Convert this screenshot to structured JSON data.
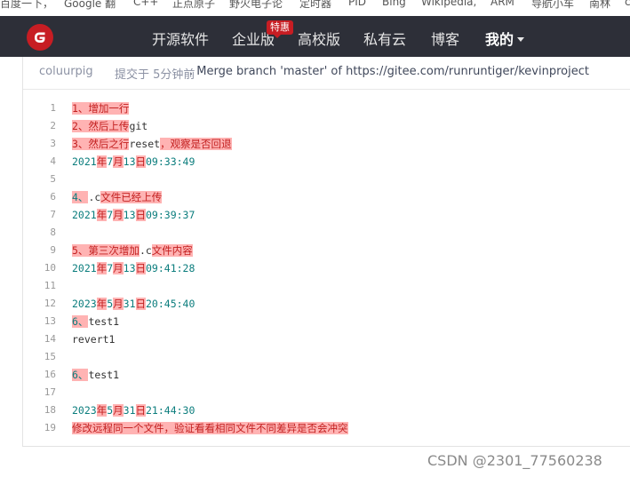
{
  "bookmarks": [
    "百度一下，",
    "Google 翻",
    "C++",
    "正点原子",
    "野火电子论",
    "定时器",
    "PID",
    "Bing",
    "Wikipedia,",
    "ARM",
    "导航小车",
    "南林",
    "c"
  ],
  "nav": {
    "logo_letter": "G",
    "items": [
      "开源软件",
      "企业版",
      "高校版",
      "私有云",
      "博客",
      "我的"
    ],
    "badge": "特惠"
  },
  "commit": {
    "author": "coluurpig",
    "time": "提交于 5分钟前",
    "message": ". Merge branch 'master' of https://gitee.com/runruntiger/kevinproject"
  },
  "code_lines": [
    {
      "num": "1",
      "parts": [
        [
          "hl",
          "1、增加一行"
        ]
      ]
    },
    {
      "num": "2",
      "parts": [
        [
          "hl",
          "2、然后上传"
        ],
        [
          "",
          "git"
        ]
      ]
    },
    {
      "num": "3",
      "parts": [
        [
          "hl",
          "3、然后之行"
        ],
        [
          "",
          "reset"
        ],
        [
          "hl",
          "，观察是否回退"
        ]
      ]
    },
    {
      "num": "4",
      "parts": [
        [
          "d",
          "2021"
        ],
        [
          "hl",
          "年"
        ],
        [
          "d",
          "7"
        ],
        [
          "hl",
          "月"
        ],
        [
          "d",
          "13"
        ],
        [
          "hl",
          "日"
        ],
        [
          "d",
          "09:33:49"
        ]
      ]
    },
    {
      "num": "5",
      "parts": []
    },
    {
      "num": "6",
      "parts": [
        [
          "hld",
          "4、"
        ],
        [
          "",
          ".c"
        ],
        [
          "hl",
          "文件已经上传"
        ]
      ]
    },
    {
      "num": "7",
      "parts": [
        [
          "d",
          "2021"
        ],
        [
          "hl",
          "年"
        ],
        [
          "d",
          "7"
        ],
        [
          "hl",
          "月"
        ],
        [
          "d",
          "13"
        ],
        [
          "hl",
          "日"
        ],
        [
          "d",
          "09:39:37"
        ]
      ]
    },
    {
      "num": "8",
      "parts": []
    },
    {
      "num": "9",
      "parts": [
        [
          "hl",
          "5、第三次增加"
        ],
        [
          "",
          ".c"
        ],
        [
          "hl",
          "文件内容"
        ]
      ]
    },
    {
      "num": "10",
      "parts": [
        [
          "d",
          "2021"
        ],
        [
          "hl",
          "年"
        ],
        [
          "d",
          "7"
        ],
        [
          "hl",
          "月"
        ],
        [
          "d",
          "13"
        ],
        [
          "hl",
          "日"
        ],
        [
          "d",
          "09:41:28"
        ]
      ]
    },
    {
      "num": "11",
      "parts": []
    },
    {
      "num": "12",
      "parts": [
        [
          "d",
          "2023"
        ],
        [
          "hl",
          "年"
        ],
        [
          "d",
          "5"
        ],
        [
          "hl",
          "月"
        ],
        [
          "d",
          "31"
        ],
        [
          "hl",
          "日"
        ],
        [
          "d",
          "20:45:40"
        ]
      ]
    },
    {
      "num": "13",
      "parts": [
        [
          "hld",
          "6、"
        ],
        [
          "",
          "test1"
        ]
      ]
    },
    {
      "num": "14",
      "parts": [
        [
          "",
          "revert1"
        ]
      ]
    },
    {
      "num": "15",
      "parts": []
    },
    {
      "num": "16",
      "parts": [
        [
          "hld",
          "6、"
        ],
        [
          "",
          "test1"
        ]
      ]
    },
    {
      "num": "17",
      "parts": []
    },
    {
      "num": "18",
      "parts": [
        [
          "d",
          "2023"
        ],
        [
          "hl",
          "年"
        ],
        [
          "d",
          "5"
        ],
        [
          "hl",
          "月"
        ],
        [
          "d",
          "31"
        ],
        [
          "hl",
          "日"
        ],
        [
          "d",
          "21:44:30"
        ]
      ]
    },
    {
      "num": "19",
      "parts": [
        [
          "hl",
          "修改远程同一个文件，验证看看相同文件不同差异是否会冲突"
        ]
      ]
    }
  ],
  "watermark": "CSDN @2301_77560238",
  "colors": {
    "nav_bg": "#2d2f38",
    "brand_red": "#c71d23",
    "highlight": "#ffb3b3"
  }
}
